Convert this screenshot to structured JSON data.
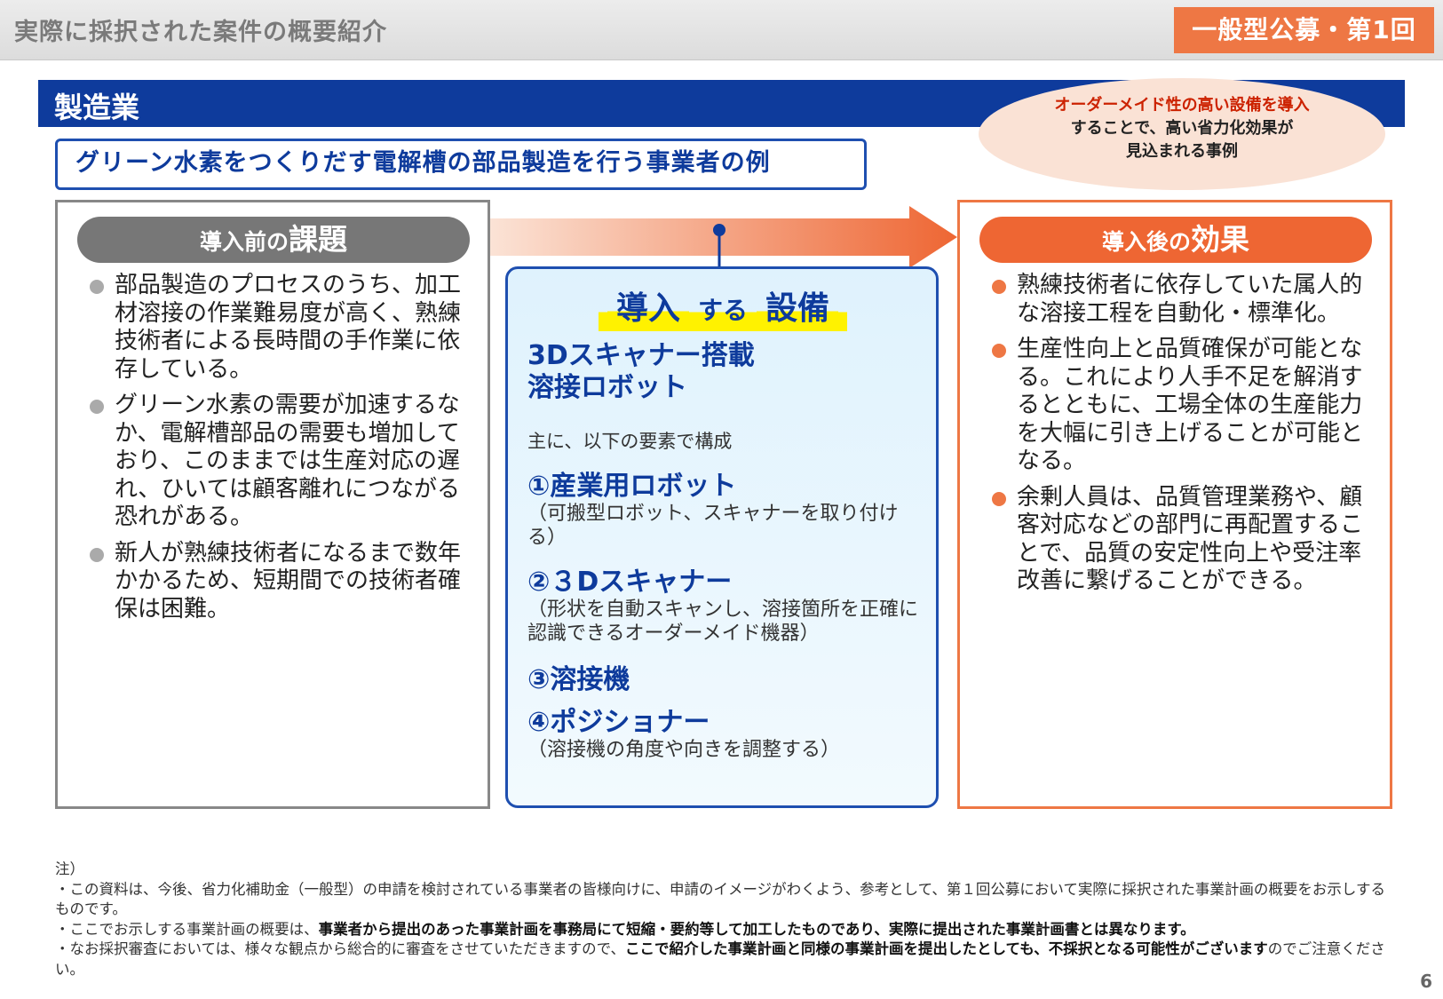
{
  "header": {
    "title": "実際に採択された案件の概要紹介",
    "badge": "一般型公募・第1回"
  },
  "category": "製造業",
  "highlight_oval": {
    "line1": "オーダーメイド性の高い設備を導入",
    "line2": "することで、高い省力化効果が",
    "line3": "見込まれる事例"
  },
  "example_title": "グリーン水素をつくりだす電解槽の部品製造を行う事業者の例",
  "before": {
    "label_small": "導入前の",
    "label_big": "課題",
    "items": [
      "部品製造のプロセスのうち、加工材溶接の作業難易度が高く、熟練技術者による長時間の手作業に依存している。",
      "グリーン水素の需要が加速するなか、電解槽部品の需要も増加しており、このままでは生産対応の遅れ、ひいては顧客離れにつながる恐れがある。",
      "新人が熟練技術者になるまで数年かかるため、短期間での技術者確保は困難。"
    ]
  },
  "equipment": {
    "heading_a": "導入",
    "heading_b": "する",
    "heading_c": "設備",
    "name_line1": "3Dスキャナー搭載",
    "name_line2": "溶接ロボット",
    "intro": "主に、以下の要素で構成",
    "components": [
      {
        "title": "①産業用ロボット",
        "desc": "（可搬型ロボット、スキャナーを取り付ける）"
      },
      {
        "title": "②３Dスキャナー",
        "desc": "（形状を自動スキャンし、溶接箇所を正確に認識できるオーダーメイド機器）"
      },
      {
        "title": "③溶接機",
        "desc": ""
      },
      {
        "title": "④ポジショナー",
        "desc": "（溶接機の角度や向きを調整する）"
      }
    ]
  },
  "after": {
    "label_small": "導入後の",
    "label_big": "効果",
    "items": [
      "熟練技術者に依存していた属人的な溶接工程を自動化・標準化。",
      "生産性向上と品質確保が可能となる。これにより人手不足を解消するとともに、工場全体の生産能力を大幅に引き上げることが可能となる。",
      "余剰人員は、品質管理業務や、顧客対応などの部門に再配置することで、品質の安定性向上や受注率改善に繋げることができる。"
    ]
  },
  "notes": {
    "label": "注）",
    "n1": "・この資料は、今後、省力化補助金（一般型）の申請を検討されている事業者の皆様向けに、申請のイメージがわくよう、参考として、第１回公募において実際に採択された事業計画の概要をお示しするものです。",
    "n2_plain": "・ここでお示しする事業計画の概要は、",
    "n2_bold": "事業者から提出のあった事業計画を事務局にて短縮・要約等して加工したものであり、実際に提出された事業計画書とは異なります。",
    "n3_plain": "・なお採択審査においては、様々な観点から総合的に審査をさせていただきますので、",
    "n3_bold": "ここで紹介した事業計画と同様の事業計画を提出したとしても、不採択となる可能性がございます",
    "n3_tail": "のでご注意ください。"
  },
  "page_number": "6"
}
